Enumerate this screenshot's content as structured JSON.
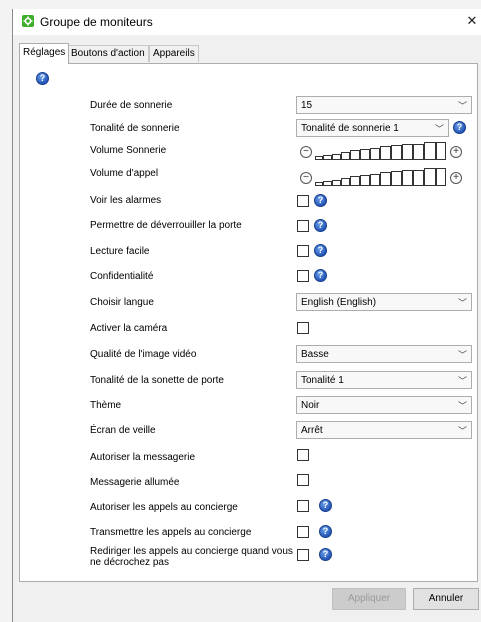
{
  "window": {
    "title": "Groupe de moniteurs",
    "close_glyph": "✕"
  },
  "tabs": [
    {
      "label": "Réglages",
      "active": true
    },
    {
      "label": "Boutons d'action",
      "active": false
    },
    {
      "label": "Appareils",
      "active": false
    }
  ],
  "settings": {
    "duree_sonnerie": {
      "label": "Durée de sonnerie",
      "value": "15"
    },
    "tonalite_sonnerie": {
      "label": "Tonalité de sonnerie",
      "value": "Tonalité de sonnerie 1"
    },
    "volume_sonnerie": {
      "label": "Volume Sonnerie",
      "level": 0.75
    },
    "volume_appel": {
      "label": "Volume d'appel",
      "level": 0.75
    },
    "voir_alarmes": {
      "label": "Voir les alarmes",
      "checked": false
    },
    "deverrouiller_porte": {
      "label": "Permettre de déverrouiller la porte",
      "checked": false
    },
    "lecture_facile": {
      "label": "Lecture facile",
      "checked": false
    },
    "confidentialite": {
      "label": "Confidentialité",
      "checked": false
    },
    "choisir_langue": {
      "label": "Choisir langue",
      "value": "English (English)"
    },
    "activer_camera": {
      "label": "Activer la caméra",
      "checked": false
    },
    "qualite_video": {
      "label": "Qualité de l'image vidéo",
      "value": "Basse"
    },
    "tonalite_porte": {
      "label": "Tonalité de la sonette de porte",
      "value": "Tonalité 1"
    },
    "theme": {
      "label": "Thème",
      "value": "Noir"
    },
    "ecran_veille": {
      "label": "Écran de veille",
      "value": "Arrêt"
    },
    "autoriser_messagerie": {
      "label": "Autoriser la messagerie",
      "checked": false
    },
    "messagerie_allumee": {
      "label": "Messagerie allumée",
      "checked": false
    },
    "autoriser_concierge": {
      "label": "Autoriser les appels au concierge",
      "checked": false
    },
    "transmettre_concierge": {
      "label": "Transmettre les appels au concierge",
      "checked": false
    },
    "rediriger_concierge": {
      "label": "Rediriger les appels au concierge quand vous ne décrochez pas",
      "checked": false
    }
  },
  "buttons": {
    "apply": "Appliquer",
    "cancel": "Annuler"
  },
  "glyphs": {
    "help": "?",
    "dropdown": "﹀",
    "minus": "−",
    "plus": "+"
  },
  "icons": {
    "app": "monitor-group-icon",
    "help": "help-icon"
  },
  "colors": {
    "accent": "#2456b8",
    "app_icon": "#3fae2a"
  }
}
